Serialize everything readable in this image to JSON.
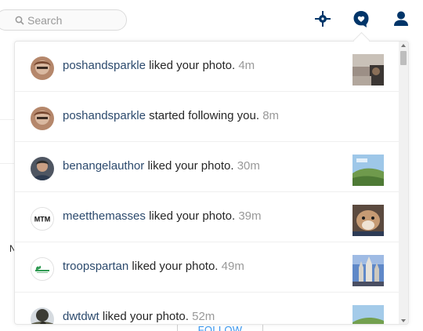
{
  "search": {
    "placeholder": "Search"
  },
  "nav": {
    "icons": [
      "compass-icon",
      "activity-heart-icon",
      "profile-icon"
    ],
    "accent": "#003569"
  },
  "background": {
    "partial_letter": "N",
    "follow_label": "FOLLOW"
  },
  "notifications": [
    {
      "user": "poshandsparkle",
      "action": "liked your photo.",
      "time": "4m",
      "has_thumb": true
    },
    {
      "user": "poshandsparkle",
      "action": "started following you.",
      "time": "8m",
      "has_thumb": false
    },
    {
      "user": "benangelauthor",
      "action": "liked your photo.",
      "time": "30m",
      "has_thumb": true
    },
    {
      "user": "meetthemasses",
      "action": "liked your photo.",
      "time": "39m",
      "has_thumb": true
    },
    {
      "user": "troopspartan",
      "action": "liked your photo.",
      "time": "49m",
      "has_thumb": true
    },
    {
      "user": "dwtdwt",
      "action": "liked your photo.",
      "time": "52m",
      "has_thumb": true
    }
  ],
  "avatars": {
    "row0_logo": "",
    "row3_logo": "MTM"
  },
  "colors": {
    "username": "#2c4a6d",
    "time": "#999999",
    "text": "#262626"
  }
}
